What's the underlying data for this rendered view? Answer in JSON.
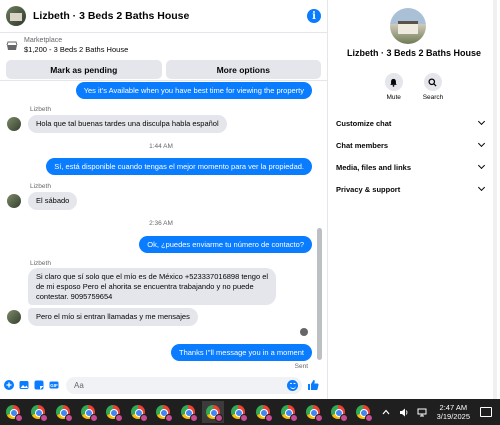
{
  "chat": {
    "title": "Lizbeth · 3 Beds 2 Baths House",
    "marketplace": {
      "label": "Marketplace",
      "listing": "$1,200 - 3 Beds 2 Baths House",
      "mark_pending": "Mark as pending",
      "more_options": "More options"
    },
    "messages": {
      "out1": "Yes it's Available when you have best time for viewing the property",
      "sender1": "Lizbeth",
      "in1": "Hola que tal buenas tardes una disculpa habla español",
      "time1": "1:44 AM",
      "out2": "Sí, está disponible cuando tengas el mejor momento para ver la propiedad.",
      "sender2": "Lizbeth",
      "in2": "El sábado",
      "time2": "2:36 AM",
      "out3": "Ok, ¿puedes enviarme tu número de contacto?",
      "sender3": "Lizbeth",
      "in3a_line1": "Si claro que sí solo que el mío es de México +523337016898  tengo el",
      "in3a_line2": "de mi esposo Pero el ahorita se encuentra trabajando y no puede",
      "in3a_line3": "contestar. 9095759654",
      "in3b": "Pero el mío si entran llamadas y me mensajes",
      "out4": "Thanks I''ll message you in a moment",
      "sent": "Sent"
    },
    "composer": {
      "placeholder": "Aa"
    }
  },
  "profile": {
    "name": "Lizbeth · 3 Beds 2 Baths House",
    "mute_label": "Mute",
    "search_label": "Search",
    "sections": [
      "Customize chat",
      "Chat members",
      "Media, files and links",
      "Privacy & support"
    ]
  },
  "taskbar": {
    "time": "2:47 AM",
    "date": "3/19/2025"
  },
  "colors": {
    "accent": "#0a7cff",
    "bubble_in": "#e4e6eb",
    "taskbar": "#1f1f1f"
  }
}
